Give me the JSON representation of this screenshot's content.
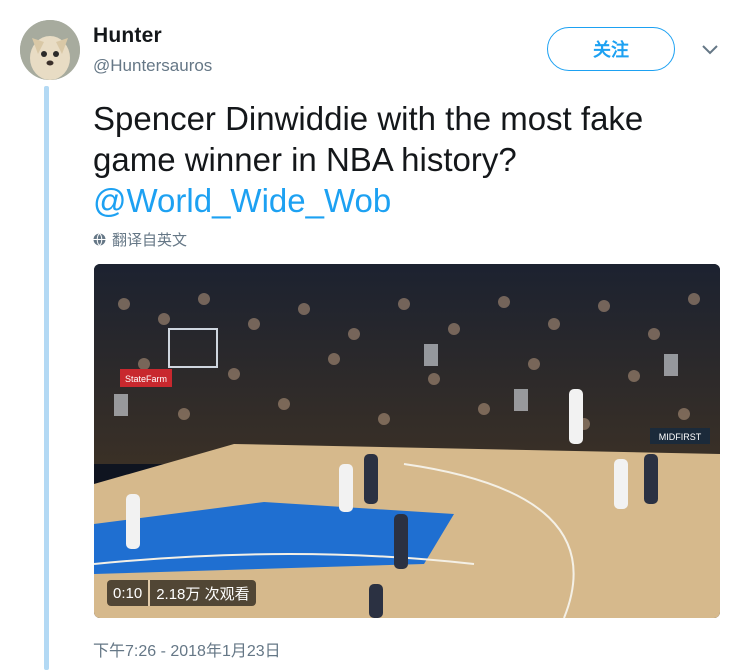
{
  "author": {
    "name": "Hunter",
    "handle": "@Huntersauros",
    "avatar_icon": "dog-avatar"
  },
  "follow_button": {
    "label": "关注",
    "color": "#1da1f2"
  },
  "menu_icon": "chevron-down-icon",
  "tweet": {
    "text_line1": "Spencer Dinwiddie with the most fake",
    "text_line2": "game winner in NBA history?",
    "mention": "@World_Wide_Wob"
  },
  "translate": {
    "icon": "globe-icon",
    "label": "翻译自英文"
  },
  "video": {
    "duration": "0:10",
    "views": "2.18万 次观看",
    "courtside_sign_left": "StateFarm",
    "courtside_sign_right": "MIDFIRST"
  },
  "timestamp": "下午7:26 - 2018年1月23日",
  "colors": {
    "link": "#1da1f2",
    "thread_line": "#b3d9f4",
    "secondary_text": "#657786"
  }
}
